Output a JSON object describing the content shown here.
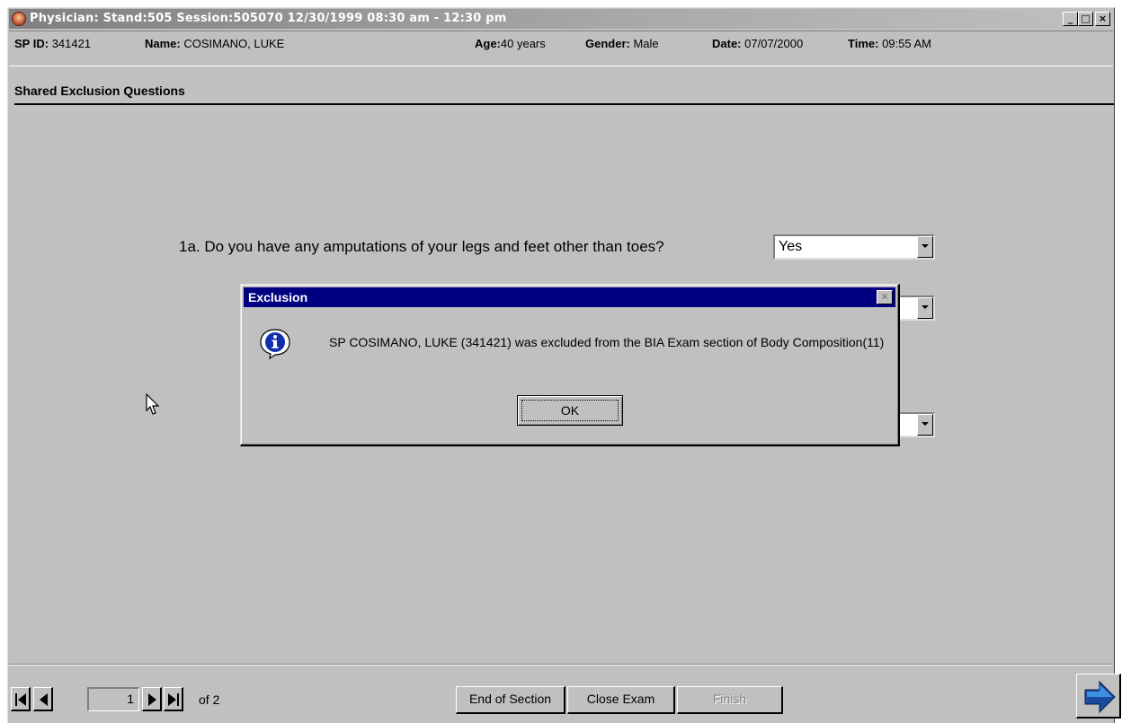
{
  "window": {
    "title": "Physician: Stand:505 Session:505070 12/30/1999 08:30 am - 12:30 pm",
    "min_glyph": "_",
    "max_glyph": "□",
    "close_glyph": "×"
  },
  "patient": {
    "sp_id_label": "SP ID:",
    "sp_id": "341421",
    "name_label": "Name:",
    "name": "COSIMANO, LUKE",
    "age_label": "Age:",
    "age": "40 years",
    "gender_label": "Gender:",
    "gender": "Male",
    "date_label": "Date:",
    "date": "07/07/2000",
    "time_label": "Time:",
    "time": "09:55 AM"
  },
  "section": {
    "title": "Shared Exclusion Questions"
  },
  "questions": [
    {
      "text": "1a. Do you have any amputations of your legs and feet other than toes?",
      "answer": "Yes"
    }
  ],
  "dialog": {
    "title": "Exclusion",
    "close_glyph": "×",
    "message": "SP COSIMANO, LUKE  (341421) was excluded from the BIA Exam section of Body Composition(11)",
    "ok_label": "OK",
    "icon": "info-icon"
  },
  "footer": {
    "page_current": "1",
    "page_of": "of 2",
    "end_section_label": "End of Section",
    "close_exam_label": "Close Exam",
    "finish_label": "Finish"
  },
  "colors": {
    "window_bg": "#c0c0c0",
    "dialog_title_bg": "#000080",
    "next_arrow": "#1a4a9c"
  }
}
